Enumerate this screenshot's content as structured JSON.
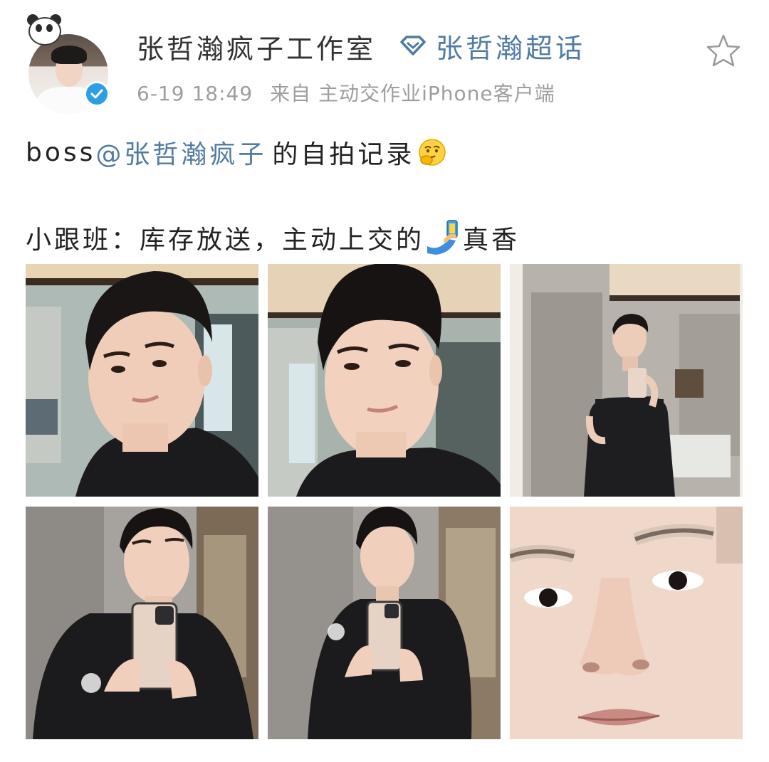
{
  "header": {
    "username": "张哲瀚疯子工作室",
    "supertopic_label": "张哲瀚超话",
    "timestamp": "6-19 18:49",
    "source_prefix": "来自",
    "source": "主动交作业iPhone客户端",
    "icons": {
      "avatar_decoration": "panda-icon",
      "verified": "verified-badge-icon",
      "supertopic": "diamond-icon",
      "favorite": "star-icon"
    }
  },
  "post": {
    "line1_prefix": "boss",
    "mention": "@张哲瀚疯子",
    "line1_suffix": "的自拍记录",
    "line1_emoji": "thinking-face-emoji",
    "line2_prefix": "小跟班：库存放送，主动上交的",
    "line2_emoji": "selfie-phone-emoji",
    "line2_suffix": "真香"
  },
  "images": [
    {
      "name": "photo-1",
      "subject": "selfie"
    },
    {
      "name": "photo-2",
      "subject": "selfie"
    },
    {
      "name": "photo-3",
      "subject": "mirror-selfie"
    },
    {
      "name": "photo-4",
      "subject": "mirror-selfie"
    },
    {
      "name": "photo-5",
      "subject": "mirror-selfie"
    },
    {
      "name": "photo-6",
      "subject": "close-up"
    }
  ],
  "colors": {
    "link": "#4f7ba5",
    "meta": "#9e9e9e",
    "verified": "#2d9ee6",
    "text": "#222222"
  }
}
